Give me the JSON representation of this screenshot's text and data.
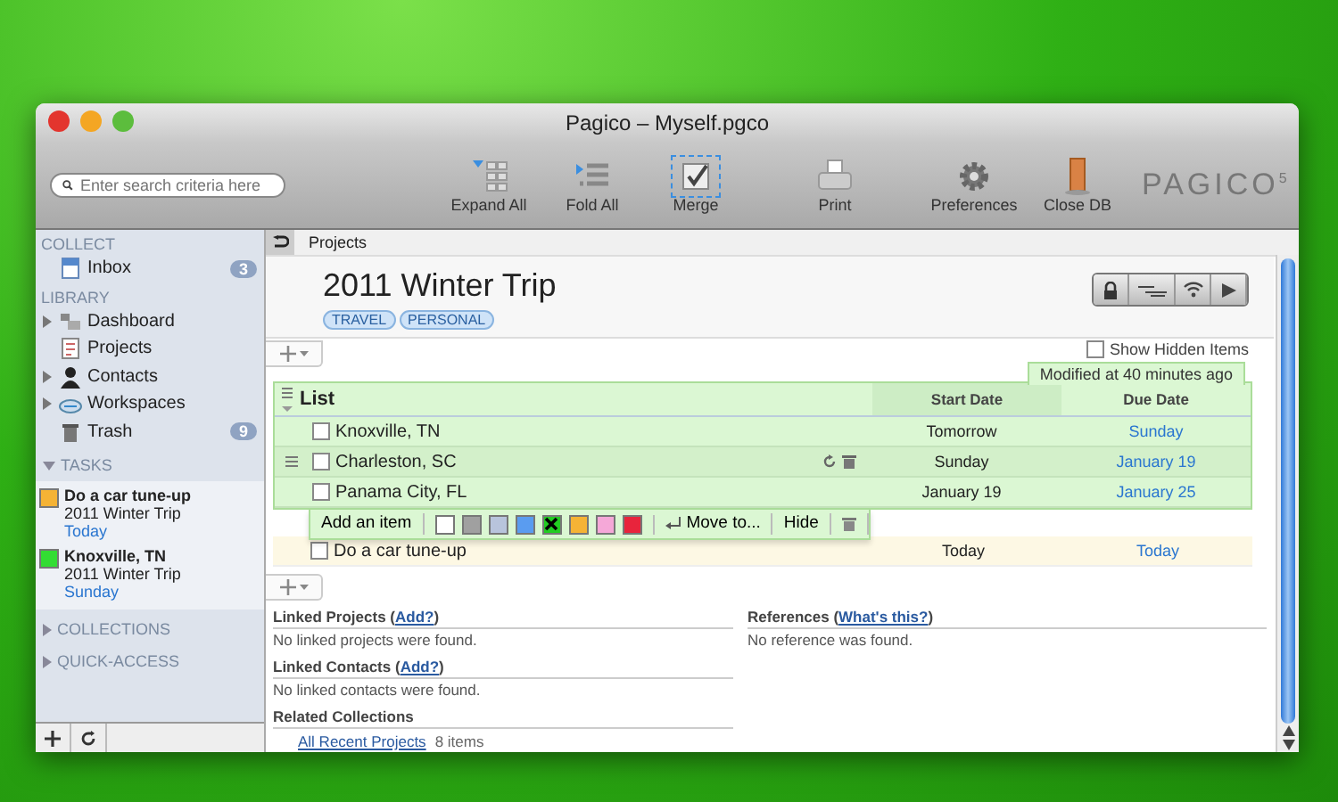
{
  "window": {
    "title": "Pagico – Myself.pgco"
  },
  "toolbar": {
    "search_placeholder": "Enter search criteria here",
    "buttons": [
      {
        "label": "Expand All",
        "kind": "expand",
        "selected": false
      },
      {
        "label": "Fold All",
        "kind": "fold",
        "selected": false
      },
      {
        "label": "Merge",
        "kind": "merge",
        "selected": true
      },
      {
        "label": "Print",
        "kind": "print",
        "selected": false
      },
      {
        "label": "Preferences",
        "kind": "gear",
        "selected": false
      },
      {
        "label": "Close DB",
        "kind": "door",
        "selected": false
      }
    ],
    "logo": "PAGICO",
    "logo_sup": "5"
  },
  "sidebar": {
    "sections": [
      {
        "title": "COLLECT",
        "items": [
          {
            "label": "Inbox",
            "kind": "inbox",
            "badge": "3",
            "expandable": false
          }
        ]
      },
      {
        "title": "LIBRARY",
        "items": [
          {
            "label": "Dashboard",
            "kind": "dashboard",
            "expandable": true
          },
          {
            "label": "Projects",
            "kind": "projects",
            "expandable": false
          },
          {
            "label": "Contacts",
            "kind": "contacts",
            "expandable": true
          },
          {
            "label": "Workspaces",
            "kind": "cloud",
            "expandable": true
          },
          {
            "label": "Trash",
            "kind": "trash",
            "badge": "9",
            "expandable": false
          }
        ]
      }
    ],
    "tasks_title": "TASKS",
    "tasks_expanded": true,
    "tasks": [
      {
        "title": "Do a car tune-up",
        "project": "2011 Winter Trip",
        "due": "Today",
        "color": "#f5b335"
      },
      {
        "title": "Knoxville, TN",
        "project": "2011 Winter Trip",
        "due": "Sunday",
        "color": "#33dd33"
      }
    ],
    "collapsed_sections": [
      "COLLECTIONS",
      "QUICK-ACCESS"
    ]
  },
  "breadcrumb": "Projects",
  "project": {
    "title": "2011 Winter Trip",
    "tags": [
      "TRAVEL",
      "PERSONAL"
    ],
    "show_hidden_label": "Show Hidden Items",
    "show_hidden": false
  },
  "list": {
    "modified": "Modified at 40 minutes ago",
    "title": "List",
    "columns": [
      "Start Date",
      "Due Date"
    ],
    "rows": [
      {
        "name": "Knoxville, TN",
        "start": "Tomorrow",
        "due": "Sunday",
        "checked": false,
        "hovered": false
      },
      {
        "name": "Charleston, SC",
        "start": "Sunday",
        "due": "January 19",
        "checked": false,
        "hovered": true
      },
      {
        "name": "Panama City, FL",
        "start": "January 19",
        "due": "January 25",
        "checked": false,
        "hovered": false
      }
    ]
  },
  "item_toolbar": {
    "add": "Add an item",
    "move": "Move to...",
    "hide": "Hide",
    "colors": [
      {
        "color": "#ffffff",
        "selected": false
      },
      {
        "color": "#a0a0a0",
        "selected": false
      },
      {
        "color": "#b8c4dc",
        "selected": false
      },
      {
        "color": "#5a9cf0",
        "selected": false
      },
      {
        "color": "#22cc22",
        "selected": true
      },
      {
        "color": "#f5b335",
        "selected": false
      },
      {
        "color": "#f5a8d8",
        "selected": false
      },
      {
        "color": "#e8243c",
        "selected": false
      }
    ]
  },
  "task_row": {
    "name": "Do a car tune-up",
    "start": "Today",
    "due": "Today",
    "checked": false
  },
  "linked": [
    {
      "title": "Linked Projects (",
      "link": "Add?",
      "after": ")",
      "empty": "No linked projects were found."
    },
    {
      "title": "Linked Contacts (",
      "link": "Add?",
      "after": ")",
      "empty": "No linked contacts were found."
    }
  ],
  "references": {
    "title": "References (",
    "link": "What's this?",
    "after": ")",
    "empty": "No reference was found."
  },
  "related": {
    "title": "Related Collections",
    "items": [
      {
        "label": "All Recent Projects",
        "count": "8 items"
      }
    ]
  }
}
